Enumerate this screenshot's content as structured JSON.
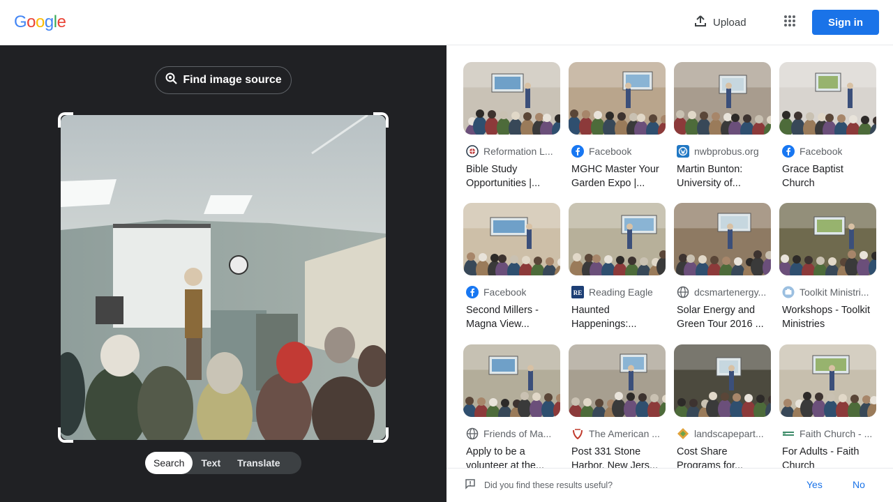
{
  "header": {
    "logo_letters": [
      "G",
      "o",
      "o",
      "g",
      "l",
      "e"
    ],
    "logo_colors": [
      "#4285F4",
      "#EA4335",
      "#FBBC05",
      "#4285F4",
      "#34A853",
      "#EA4335"
    ],
    "upload_label": "Upload",
    "sign_in_label": "Sign in",
    "sign_in_color": "#1a73e8"
  },
  "left": {
    "find_source_label": "Find image source",
    "modes": [
      "Search",
      "Text",
      "Translate"
    ],
    "active_mode": "Search"
  },
  "results": [
    {
      "source": "Reformation L...",
      "icon": "reformation-logo-icon",
      "title": "Bible Study Opportunities |...",
      "theme": "#c9c2b6"
    },
    {
      "source": "Facebook",
      "icon": "facebook-icon",
      "title": "MGHC Master Your Garden Expo |...",
      "theme": "#b9a58c"
    },
    {
      "source": "nwbprobus.org",
      "icon": "wordpress-icon",
      "title": "Martin Bunton: University of...",
      "theme": "#a89c8e"
    },
    {
      "source": "Facebook",
      "icon": "facebook-icon",
      "title": "Grace Baptist Church",
      "theme": "#d8d4cf"
    },
    {
      "source": "Facebook",
      "icon": "facebook-icon",
      "title": "Second Millers - Magna View...",
      "theme": "#cdbfa8"
    },
    {
      "source": "Reading Eagle",
      "icon": "reading-eagle-icon",
      "title": "Haunted Happenings:...",
      "theme": "#b7b09a"
    },
    {
      "source": "dcsmartenergy...",
      "icon": "globe-icon",
      "title": "Solar Energy and Green Tour 2016 ...",
      "theme": "#8e7a63"
    },
    {
      "source": "Toolkit Ministri...",
      "icon": "toolkit-icon",
      "title": "Workshops - Toolkit Ministries",
      "theme": "#6f6a4e"
    },
    {
      "source": "Friends of Ma...",
      "icon": "globe-icon",
      "title": "Apply to be a volunteer at the...",
      "theme": "#b3ad9a"
    },
    {
      "source": "The American ...",
      "icon": "american-legion-icon",
      "title": "Post 331 Stone Harbor, New Jers...",
      "theme": "#a79f90"
    },
    {
      "source": "landscapepart...",
      "icon": "landscape-icon",
      "title": "Cost Share Programs for...",
      "theme": "#4c4a3e"
    },
    {
      "source": "Faith Church - ...",
      "icon": "faith-church-icon",
      "title": "For Adults - Faith Church",
      "theme": "#c7bfae"
    }
  ],
  "feedback": {
    "question": "Did you find these results useful?",
    "yes": "Yes",
    "no": "No"
  }
}
